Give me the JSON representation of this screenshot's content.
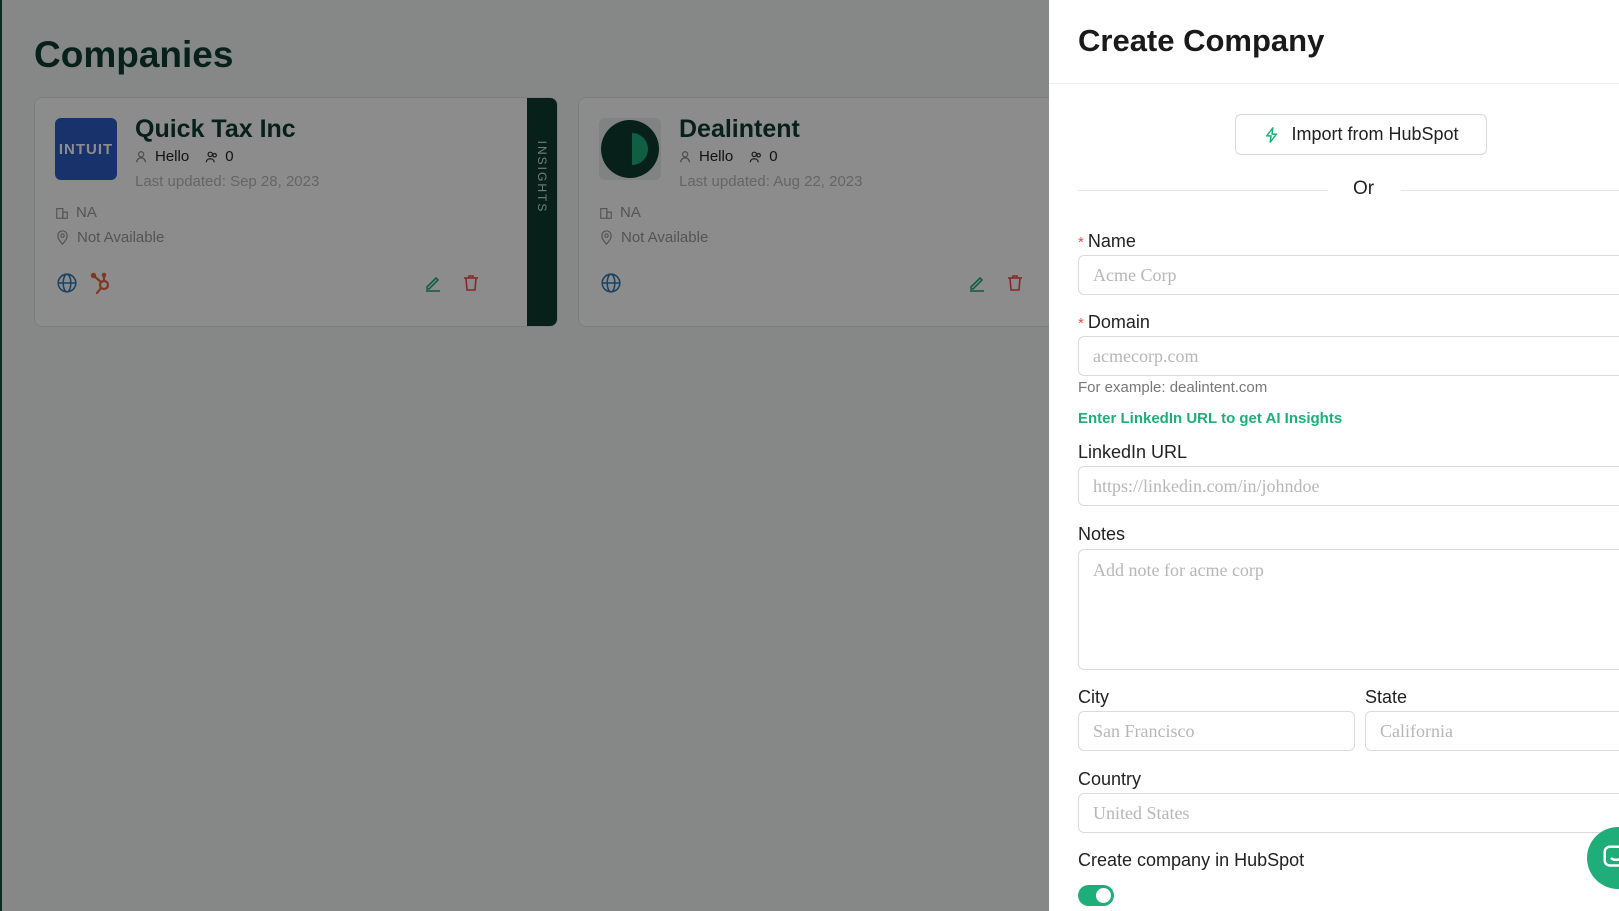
{
  "page": {
    "title": "Companies"
  },
  "companies": [
    {
      "name": "Quick Tax Inc",
      "logo_text": "INTUIT",
      "owner": "Hello",
      "contacts": "0",
      "updated": "Last updated: Sep 28, 2023",
      "industry": "NA",
      "location": "Not Available",
      "insights_label": "INSIGHTS"
    },
    {
      "name": "Dealintent",
      "owner": "Hello",
      "contacts": "0",
      "updated": "Last updated: Aug 22, 2023",
      "industry": "NA",
      "location": "Not Available"
    }
  ],
  "drawer": {
    "title": "Create Company",
    "import_label": "Import from HubSpot",
    "or_text": "Or",
    "name": {
      "label": "Name",
      "placeholder": "Acme Corp"
    },
    "domain": {
      "label": "Domain",
      "placeholder": "acmecorp.com",
      "hint": "For example: dealintent.com"
    },
    "linkedin_cta": "Enter LinkedIn URL to get AI Insights",
    "linkedin": {
      "label": "LinkedIn URL",
      "placeholder": "https://linkedin.com/in/johndoe"
    },
    "notes": {
      "label": "Notes",
      "placeholder": "Add note for acme corp"
    },
    "city": {
      "label": "City",
      "placeholder": "San Francisco"
    },
    "state": {
      "label": "State",
      "placeholder": "California"
    },
    "country": {
      "label": "Country",
      "placeholder": "United States"
    },
    "hubspot_toggle": {
      "label": "Create company in HubSpot",
      "checked": true
    }
  },
  "colors": {
    "brand_dark": "#0e3b2e",
    "accent_green": "#1fae7a",
    "danger": "#e5534b",
    "hubspot_orange": "#e8643c"
  }
}
